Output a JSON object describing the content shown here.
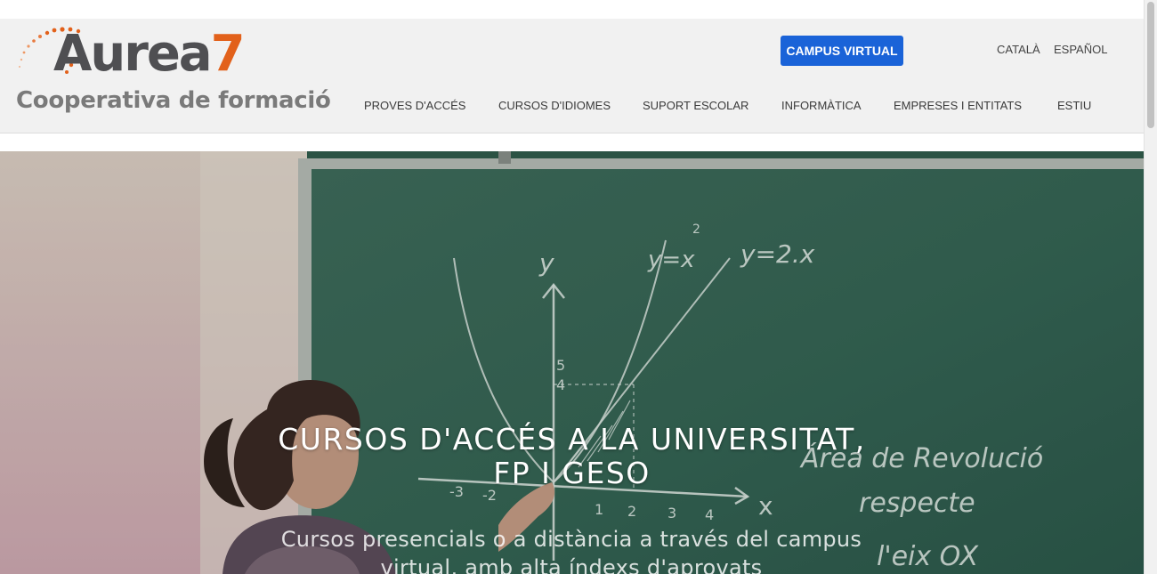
{
  "logo": {
    "word": "Aurea",
    "seven": "7",
    "tagline": "Cooperativa de formació"
  },
  "header": {
    "campus_button": "CAMPUS VIRTUAL",
    "languages": [
      "CATALÀ",
      "ESPAÑOL"
    ],
    "nav": [
      "PROVES D'ACCÉS",
      "CURSOS D'IDIOMES",
      "SUPORT ESCOLAR",
      "INFORMÀTICA",
      "EMPRESES I ENTITATS",
      "ESTIU"
    ]
  },
  "hero": {
    "title_line1": "CURSOS D'ACCÉS A LA UNIVERSITAT,",
    "title_line2": "FP I GESO",
    "subtitle_line1": "Cursos presencials o a distància a través del campus",
    "subtitle_line2": "virtual, amb alta índexs d'aprovats",
    "board_text": [
      "y",
      "y=x",
      "2",
      "y=2.x",
      "5",
      "4",
      "x",
      "Área de Revolució",
      "respecte",
      "l'eix OX",
      "-3",
      "-2",
      "1",
      "2",
      "3",
      "4"
    ]
  },
  "colors": {
    "brand_blue": "#1a63d8",
    "brand_orange": "#e2611b",
    "board_green": "#2f5a4a"
  }
}
